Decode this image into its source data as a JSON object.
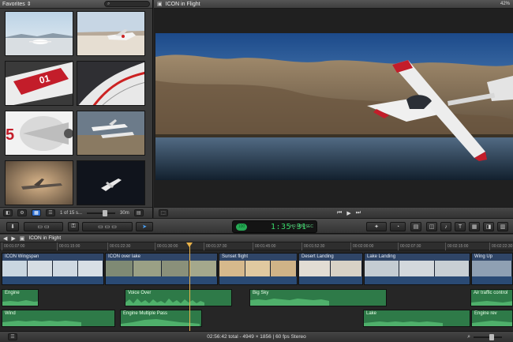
{
  "browser": {
    "library_label": "Favorites",
    "clip_count": "1 of 15 s...",
    "duration": "30m"
  },
  "viewer": {
    "title": "ICON in Flight",
    "zoom": "42%"
  },
  "toolbar": {
    "timecode": "1:35.31",
    "timecode_badge": "100",
    "timecode_sub": "HR MIN SEC"
  },
  "timeline": {
    "title": "ICON in Flight",
    "ruler": [
      "00:01:07:00",
      "00:01:15:00",
      "00:01:22:30",
      "00:01:30:00",
      "00:01:37:30",
      "00:01:45:00",
      "00:01:52:30",
      "00:02:00:00",
      "00:02:07:30",
      "00:02:15:00",
      "00:02:22:30"
    ],
    "video_clips": [
      {
        "label": "ICON Wingspan"
      },
      {
        "label": "ICON over lake"
      },
      {
        "label": "Sunset flight"
      },
      {
        "label": "Desert Landing"
      },
      {
        "label": "Lake Landing"
      },
      {
        "label": "Wing Up"
      }
    ],
    "audio_row1": [
      {
        "label": "Engine"
      },
      {
        "label": "Voice Over"
      },
      {
        "label": "Big Sky"
      },
      {
        "label": "Air traffic control"
      }
    ],
    "audio_row2": [
      {
        "label": "Wind"
      },
      {
        "label": "Engine Multiple Pass"
      },
      {
        "label": "Lake"
      },
      {
        "label": "Engine rev"
      }
    ]
  },
  "status": {
    "summary": "02:56:42 total - 4949 × 1856 | 60 fps Stereo"
  },
  "colors": {
    "accent": "#2f6fd0",
    "timecode_green": "#39d66a",
    "audio_clip": "#2e7a48",
    "video_clip": "#3a4e6e",
    "playhead": "#e9b24a"
  }
}
